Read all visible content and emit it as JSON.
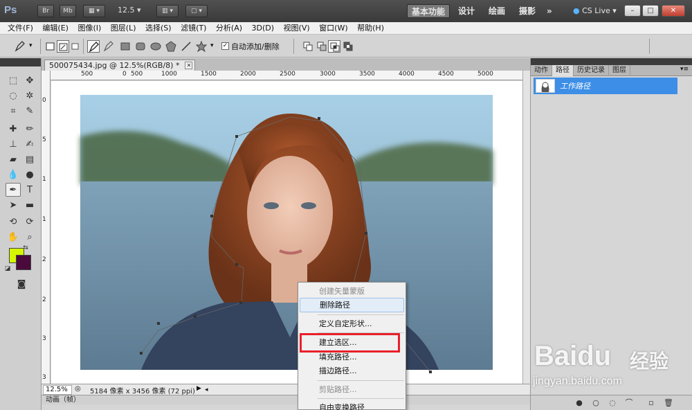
{
  "app": {
    "logo": "Ps",
    "bridge_btn": "Br",
    "minibridge_btn": "Mb",
    "zoom_value": "12.5",
    "workspaces": [
      "基本功能",
      "设计",
      "绘画",
      "摄影"
    ],
    "more": "»",
    "cslive": "CS Live"
  },
  "menu": [
    "文件(F)",
    "编辑(E)",
    "图像(I)",
    "图层(L)",
    "选择(S)",
    "滤镜(T)",
    "分析(A)",
    "3D(D)",
    "视图(V)",
    "窗口(W)",
    "帮助(H)"
  ],
  "options": {
    "auto_add_delete_label": "自动添加/删除",
    "auto_add_delete_checked": true
  },
  "document": {
    "tab_title": "500075434.jpg @ 12.5%(RGB/8) *",
    "ruler_top": [
      "500",
      "0",
      "500",
      "1000",
      "1500",
      "2000",
      "2500",
      "3000",
      "3500",
      "4000",
      "4500",
      "5000"
    ],
    "ruler_left": [
      "0",
      "5",
      "1",
      "1",
      "2",
      "2",
      "3",
      "3"
    ],
    "status_zoom": "12.5%",
    "status_info": "5184 像素 x 3456 像素 (72 ppi)",
    "animation_label": "动画（帧）"
  },
  "panel": {
    "tabs": [
      "动作",
      "路径",
      "历史记录",
      "图层"
    ],
    "active_tab": "路径",
    "path_name": "工作路径"
  },
  "context_menu": {
    "items": [
      {
        "label": "创建矢量蒙版",
        "disabled": true
      },
      {
        "label": "删除路径",
        "disabled": false,
        "hover": true
      },
      {
        "label": "定义自定形状...",
        "disabled": false
      },
      {
        "label": "建立选区...",
        "disabled": false,
        "highlighted": true
      },
      {
        "label": "填充路径...",
        "disabled": false
      },
      {
        "label": "描边路径...",
        "disabled": false
      },
      {
        "label": "剪贴路径...",
        "disabled": true
      },
      {
        "label": "自由变换路径",
        "disabled": false
      }
    ]
  },
  "colors": {
    "foreground": "#d6f500",
    "background": "#4a0a3c",
    "highlight_box": "#e8202a",
    "panel_selection": "#3d8ee6"
  },
  "watermark": {
    "brand": "Baidu",
    "cn": "经验",
    "url": "jingyan.baidu.com"
  }
}
